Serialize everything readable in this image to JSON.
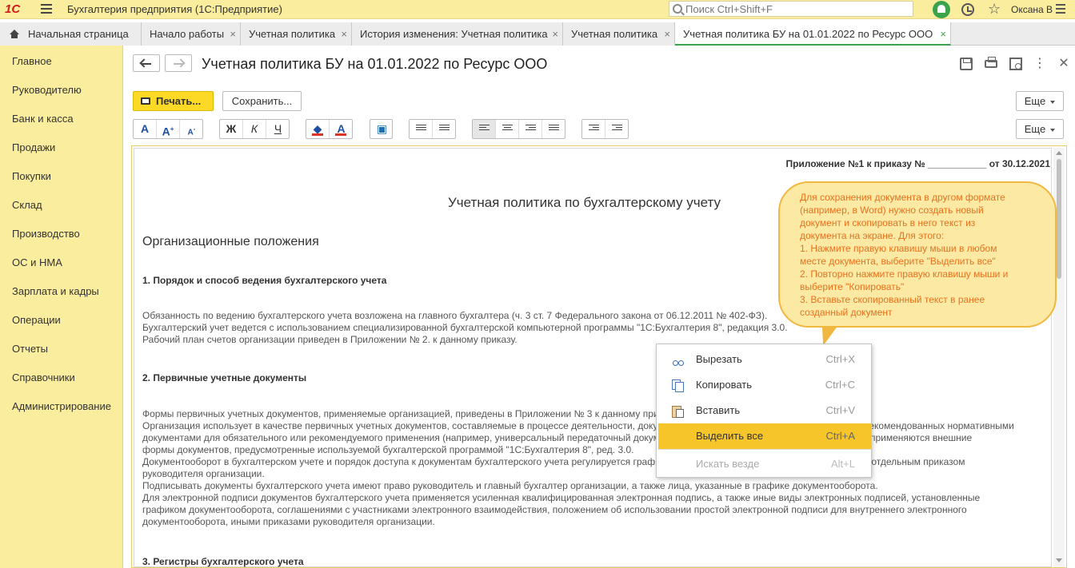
{
  "topbar": {
    "logo": "1С",
    "app_title": "Бухгалтерия предприятия  (1С:Предприятие)",
    "search_placeholder": "Поиск Ctrl+Shift+F",
    "user": "Оксана В"
  },
  "tabs": [
    {
      "label": "Начальная страница",
      "closable": false
    },
    {
      "label": "Начало работы",
      "closable": true
    },
    {
      "label": "Учетная политика",
      "closable": true
    },
    {
      "label": "История изменения: Учетная политика",
      "closable": true
    },
    {
      "label": "Учетная политика",
      "closable": true
    },
    {
      "label": "Учетная политика БУ на 01.01.2022 по Ресурс ООО",
      "closable": true,
      "active": true
    }
  ],
  "tab_close_glyph": "×",
  "sidebar": {
    "items": [
      "Главное",
      "Руководителю",
      "Банк и касса",
      "Продажи",
      "Покупки",
      "Склад",
      "Производство",
      "ОС и НМА",
      "Зарплата и кадры",
      "Операции",
      "Отчеты",
      "Справочники",
      "Администрирование"
    ]
  },
  "form": {
    "title": "Учетная политика БУ на 01.01.2022 по Ресурс ООО",
    "print_button": "Печать...",
    "save_button": "Сохранить...",
    "more_button": "Еще",
    "more_button_2": "Еще"
  },
  "format_toolbar": {
    "font": [
      "A",
      "A",
      "A"
    ],
    "style": [
      "Ж",
      "К",
      "Ч"
    ],
    "color": [
      "A"
    ]
  },
  "document": {
    "appendix": "Приложение №1 к приказу № ___________ от 30.12.2021",
    "title": "Учетная политика по бухгалтерскому учету",
    "section": "Организационные положения",
    "h1": "1. Порядок и способ ведения бухгалтерского учета",
    "p1": [
      "Обязанность по ведению бухгалтерского учета возложена на главного бухгалтера (ч. 3 ст. 7 Федерального закона от 06.12.2011 № 402-ФЗ).",
      "Бухгалтерский учет ведется с использованием специализированной бухгалтерской компьютерной программы \"1С:Бухгалтерия 8\", редакция 3.0.",
      "Рабочий план счетов организации приведен в Приложении № 2. к данному приказу."
    ],
    "h2": "2. Первичные учетные документы",
    "p2": [
      "Формы первичных учетных документов, применяемые организацией, приведены в Приложении № 3 к данному приказу.",
      "Организация использует в качестве первичных учетных документов, составляемые в процессе деятельности, документы установленных форм, а также формы, рекомендованных нормативными",
      "документами для обязательного или рекомендуемого применения (например, универсальный передаточный документ, счет-фактура, акт сверки и др.). При этом, применяются внешние",
      "формы документов, предусмотренные используемой бухгалтерской программой \"1С:Бухгалтерия 8\", ред. 3.0.",
      "Документооборот в бухгалтерском учете и порядок доступа к документам бухгалтерского учета регулируется графиком документооборота, который утверждается отдельным приказом",
      "руководителя организации.",
      "Подписывать документы бухгалтерского учета имеют право руководитель и главный бухгалтер организации, а также лица, указанные в графике документооборота.",
      "Для электронной подписи документов бухгалтерского учета применяется усиленная квалифицированная электронная подпись, а также иные виды электронных подписей, установленные",
      "графиком документооборота, соглашениями с участниками электронного взаимодействия, положением об использовании простой электронной подписи для внутреннего электронного",
      "документооборота, иными приказами руководителя организации."
    ],
    "h3": "3. Регистры бухгалтерского учета"
  },
  "callout": {
    "lines": [
      "Для сохранения документа в другом формате",
      "(например, в Word) нужно создать новый",
      "документ и скопировать в него текст из",
      "документа на экране. Для этого:",
      "1. Нажмите правую клавишу мыши в любом",
      "месте документа, выберите \"Выделить все\"",
      "2. Повторно нажмите правую клавишу мыши и",
      "выберите \"Копировать\"",
      "3. Вставьте скопированный текст в ранее",
      "созданный документ"
    ]
  },
  "context_menu": {
    "items": [
      {
        "label": "Вырезать",
        "shortcut": "Ctrl+X",
        "icon": "scissors-icon"
      },
      {
        "label": "Копировать",
        "shortcut": "Ctrl+C",
        "icon": "copy-icon"
      },
      {
        "label": "Вставить",
        "shortcut": "Ctrl+V",
        "icon": "paste-icon"
      },
      {
        "label": "Выделить все",
        "shortcut": "Ctrl+A",
        "selected": true
      },
      {
        "label": "Искать везде",
        "shortcut": "Alt+L",
        "disabled": true
      }
    ]
  }
}
